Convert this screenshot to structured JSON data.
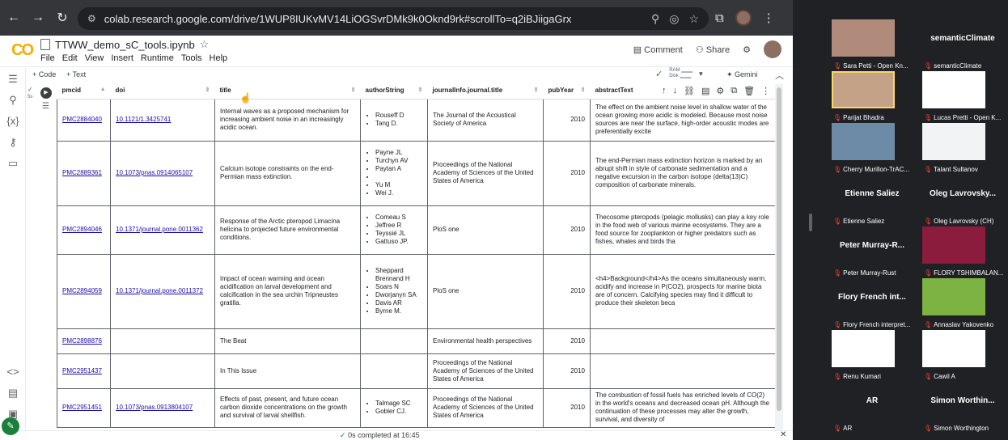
{
  "browser": {
    "url": "colab.research.google.com/drive/1WUP8IUKvMV14LiOGSvrDMk9k0Oknd9rk#scrollTo=q2iBJiigaGrx"
  },
  "colab": {
    "logo": "CO",
    "notebook_name": "TTWW_demo_sC_tools.ipynb",
    "menu": [
      "File",
      "Edit",
      "View",
      "Insert",
      "Runtime",
      "Tools",
      "Help"
    ],
    "comment_label": "Comment",
    "share_label": "Share",
    "add_code": "+ Code",
    "add_text": "+ Text",
    "ram_label": "RAM",
    "disk_label": "Disk",
    "gemini_label": "Gemini",
    "cell_secs": "5s",
    "status": "0s   completed at 16:45"
  },
  "table": {
    "headers": [
      "pmcid",
      "doi",
      "title",
      "authorString",
      "journalInfo.journal.title",
      "pubYear",
      "abstractText"
    ],
    "rows": [
      {
        "pmcid": "PMC2884040",
        "doi": "10.1121/1.3425741",
        "title": "Internal waves as a proposed mechanism for increasing ambient noise in an increasingly acidic ocean.",
        "authors": [
          "Rouseff D",
          "Tang D."
        ],
        "journal": "The Journal of the Acoustical Society of America",
        "year": "2010",
        "abstract": "The effect on the ambient noise level in shallow water of the ocean growing more acidic is modeled. Because most noise sources are near the surface, high-order acoustic modes are preferentially excite"
      },
      {
        "pmcid": "PMC2889361",
        "doi": "10.1073/pnas.0914065107",
        "title": "Calcium isotope constraints on the end-Permian mass extinction.",
        "authors": [
          "Payne JL",
          "Turchyn AV",
          "Paytan A",
          "",
          "Yu M",
          "Wei J."
        ],
        "journal": "Proceedings of the National Academy of Sciences of the United States of America",
        "year": "2010",
        "abstract": "The end-Permian mass extinction horizon is marked by an abrupt shift in style of carbonate sedimentation and a negative excursion in the carbon isotope (delta(13)C) composition of carbonate minerals."
      },
      {
        "pmcid": "PMC2894046",
        "doi": "10.1371/journal.pone.0011362",
        "title": "Response of the Arctic pteropod Limacina helicina to projected future environmental conditions.",
        "authors": [
          "Comeau S",
          "Jeffree R",
          "Teyssié JL",
          "Gattuso JP."
        ],
        "journal": "PloS one",
        "year": "2010",
        "abstract": "Thecosome pteropods (pelagic mollusks) can play a key role in the food web of various marine ecosystems. They are a food source for zooplankton or higher predators such as fishes, whales and birds tha"
      },
      {
        "pmcid": "PMC2894059",
        "doi": "10.1371/journal.pone.0011372",
        "title": "Impact of ocean warming and ocean acidification on larval development and calcification in the sea urchin Tripneustes gratilla.",
        "authors": [
          "Sheppard Brennand H",
          "Soars N",
          "Dworjanyn SA",
          "Davis AR",
          "Byrne M."
        ],
        "journal": "PloS one",
        "year": "2010",
        "abstract": "<h4>Background</h4>As the oceans simultaneously warm, acidify and increase in P(CO2), prospects for marine biota are of concern. Calcifying species may find it difficult to produce their skeleton beca"
      },
      {
        "pmcid": "PMC2898876",
        "doi": "",
        "title": "The Beat",
        "authors": [],
        "journal": "Environmental health perspectives",
        "year": "2010",
        "abstract": ""
      },
      {
        "pmcid": "PMC2951437",
        "doi": "",
        "title": "In This Issue",
        "authors": [],
        "journal": "Proceedings of the National Academy of Sciences of the United States of America",
        "year": "2010",
        "abstract": ""
      },
      {
        "pmcid": "PMC2951451",
        "doi": "10.1073/pnas.0913804107",
        "title": "Effects of past, present, and future ocean carbon dioxide concentrations on the growth and survival of larval shellfish.",
        "authors": [
          "Talmage SC",
          "Gobler CJ."
        ],
        "journal": "Proceedings of the National Academy of Sciences of the United States of America",
        "year": "2010",
        "abstract": "The combustion of fossil fuels has enriched levels of CO(2) in the world's oceans and decreased ocean pH. Although the continuation of these processes may alter the growth, survival, and diversity of"
      }
    ]
  },
  "meet": {
    "participants": [
      {
        "name": "Sara Petti - Open Kn...",
        "big": "",
        "pic": "#b08a7a",
        "active": false
      },
      {
        "name": "semanticClimate",
        "big": "semanticClimate",
        "pic": "",
        "active": false
      },
      {
        "name": "Parijat Bhadra",
        "big": "",
        "pic": "#c4a287",
        "active": true
      },
      {
        "name": "Lucas Pretti - Open K...",
        "big": "",
        "pic": "#ffffff",
        "active": false
      },
      {
        "name": "Cherry Murillon-TrAC...",
        "big": "",
        "pic": "#6d8aa6",
        "active": false
      },
      {
        "name": "Talant Sultanov",
        "big": "",
        "pic": "#f1f3f4",
        "active": false
      },
      {
        "name": "Etienne Saliez",
        "big": "Etienne Saliez",
        "pic": "",
        "active": false
      },
      {
        "name": "Oleg Lavrovsky (CH)",
        "big": "Oleg Lavrovsky...",
        "pic": "",
        "active": false
      },
      {
        "name": "Peter Murray-Rust",
        "big": "Peter Murray-R...",
        "pic": "",
        "active": false
      },
      {
        "name": "FLORY TSHIMBALAN...",
        "big": "",
        "pic": "#8b1c3d",
        "active": false
      },
      {
        "name": "Flory French interpret...",
        "big": "Flory French int...",
        "pic": "",
        "active": false
      },
      {
        "name": "Annaslav Yakovenko",
        "big": "",
        "pic": "#7cb342",
        "active": false
      },
      {
        "name": "Renu Kumari",
        "big": "",
        "pic": "#ffffff",
        "active": false
      },
      {
        "name": "Cawil A",
        "big": "",
        "pic": "#ffffff",
        "active": false
      },
      {
        "name": "AR",
        "big": "AR",
        "pic": "",
        "active": false
      },
      {
        "name": "Simon Worthington",
        "big": "Simon  Worthin...",
        "pic": "",
        "active": false
      }
    ]
  }
}
